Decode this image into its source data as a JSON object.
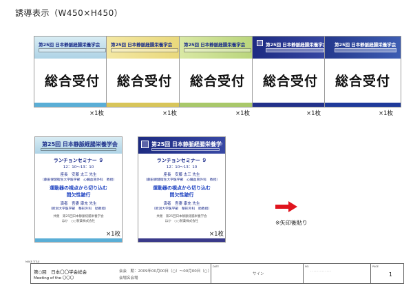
{
  "heading": "誘導表示（W450×H450）",
  "reception_signs": [
    {
      "band_title": "第25回 日本静脈経腸栄養学会",
      "main_text": "総合受付",
      "qty": "×1枚",
      "style": "aqua",
      "accent": "#5aaed6"
    },
    {
      "band_title": "第25回 日本静脈経腸栄養学会",
      "main_text": "総合受付",
      "qty": "×1枚",
      "style": "gold",
      "accent": "#d8c55a"
    },
    {
      "band_title": "第25回 日本静脈経腸栄養学会",
      "main_text": "総合受付",
      "qty": "×1枚",
      "style": "green",
      "accent": "#a9c86a"
    },
    {
      "band_title": "第25回 日本静脈経腸栄養学会",
      "main_text": "総合受付",
      "qty": "×1枚",
      "style": "navy",
      "accent": "#22318a"
    },
    {
      "band_title": "第25回 日本静脈経腸栄養学会",
      "main_text": "総合受付",
      "qty": "×1枚",
      "style": "blue",
      "accent": "#1f3a9a"
    }
  ],
  "seminar_signs": [
    {
      "band_title": "第25回 日本静脈経腸栄養学会",
      "style": "aqua",
      "accent": "#5aaed6",
      "qty": "×1枚",
      "seminar_name": "ランチョンセミナー ９",
      "time": "12：10～13：10",
      "chair": "座長　安藤 太三 先生",
      "chair_affiliation": "（藤田保健衛生大学医学部　心臓血管外科　教授）",
      "talk_title_1": "運動器の視点から切り込む",
      "talk_title_2": "間欠性跛行",
      "speaker": "演者　吾妻 康充 先生",
      "speaker_affiliation": "（新潟大学医学部　整形外科　助教授）",
      "cosponsor_1": "共催　第25回日本静脈経腸栄養学会",
      "cosponsor_2": "ほか　○○製薬株式会社"
    },
    {
      "band_title": "第25回 日本静脈経腸栄養学会",
      "style": "navy",
      "accent": "#3a3a8a",
      "qty": "×1枚",
      "seminar_name": "ランチョンセミナー ９",
      "time": "12：10～13：10",
      "chair": "座長　安藤 太三 先生",
      "chair_affiliation": "（藤田保健衛生大学医学部　心臓血管外科　教授）",
      "talk_title_1": "運動器の視点から切り込む",
      "talk_title_2": "間欠性跛行",
      "speaker": "演者　吾妻 康充 先生",
      "speaker_affiliation": "（新潟大学医学部　整形外科　助教授）",
      "cosponsor_1": "共催　第25回日本静脈経腸栄養学会",
      "cosponsor_2": "ほか　○○製薬株式会社"
    }
  ],
  "arrow_color": "#e0141e",
  "arrow_note": "※矢印後貼り",
  "title_block": {
    "corner_label": "MAKE TITLE",
    "conference": "第○回　日本〇〇学会総会",
    "conference_en": "Meeting of the 〇〇〇",
    "info_line1": "会会　期：2009年00月00日（○）～00月00日（○）",
    "info_line2": "会場名会場",
    "date_label": "DATE",
    "signature": "サイン",
    "number_label": "NO.",
    "dashes": "- - - - - - - - - - - - -",
    "page_label": "PAGE",
    "page_number": "1"
  }
}
